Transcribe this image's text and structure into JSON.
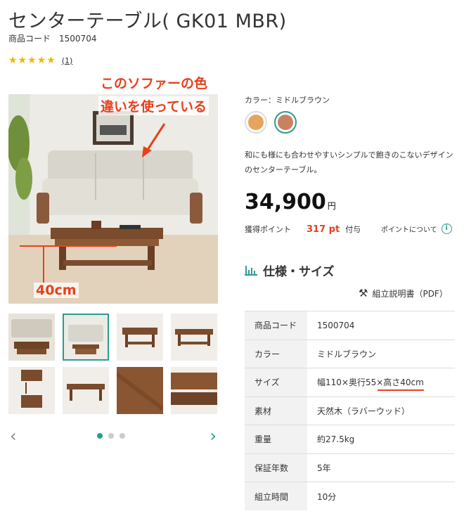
{
  "product": {
    "title": "センターテーブル( GK01 MBR)",
    "code_label": "商品コード",
    "code_value": "1500704",
    "stars": "★★★★★",
    "review_count": "(1)"
  },
  "annotations": {
    "line1": "このソファーの色",
    "line2": "違いを使っている",
    "height": "40cm"
  },
  "gallery": {
    "prev": "‹",
    "next": "›"
  },
  "options": {
    "color_label": "カラー：ミドルブラウン",
    "swatch_colors": [
      "#e6a55c",
      "#c9825f"
    ]
  },
  "description": "和にも様にも合わせやすいシンプルで飽きのこないデザインのセンターテーブル。",
  "pricing": {
    "price": "34,900",
    "yen": "円",
    "points_label": "獲得ポイント",
    "points_value": "317 pt",
    "points_suffix": "付与",
    "points_about": "ポイントについて"
  },
  "spec": {
    "heading": "仕様・サイズ",
    "manual": "組立説明書（PDF）",
    "rows": [
      {
        "k": "商品コード",
        "v": "1500704"
      },
      {
        "k": "カラー",
        "v": "ミドルブラウン"
      },
      {
        "k": "サイズ",
        "v": "幅110×奥行55×高さ40cm"
      },
      {
        "k": "素材",
        "v": "天然木（ラバーウッド）"
      },
      {
        "k": "重量",
        "v": "約27.5kg"
      },
      {
        "k": "保証年数",
        "v": "5年"
      },
      {
        "k": "組立時間",
        "v": "10分"
      }
    ]
  },
  "colors": {
    "accent": "#2a9d8f",
    "annotation_red": "#e8401c",
    "star": "#f4b400"
  }
}
